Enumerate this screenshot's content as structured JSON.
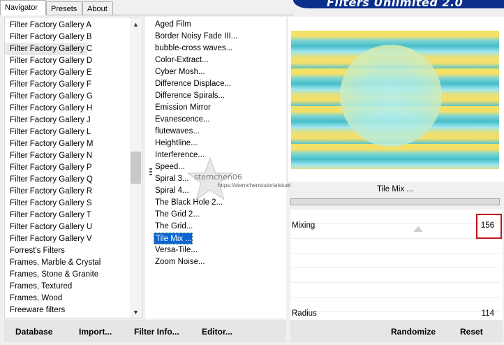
{
  "tabs": [
    {
      "label": "Navigator",
      "active": true
    },
    {
      "label": "Presets",
      "active": false
    },
    {
      "label": "About",
      "active": false
    }
  ],
  "banner": {
    "title": "Filters Unlimited 2.0",
    "color": "#0b2f8a"
  },
  "categories": [
    "Filter Factory Gallery A",
    "Filter Factory Gallery B",
    "Filter Factory Gallery C",
    "Filter Factory Gallery D",
    "Filter Factory Gallery E",
    "Filter Factory Gallery F",
    "Filter Factory Gallery G",
    "Filter Factory Gallery H",
    "Filter Factory Gallery J",
    "Filter Factory Gallery L",
    "Filter Factory Gallery M",
    "Filter Factory Gallery N",
    "Filter Factory Gallery P",
    "Filter Factory Gallery Q",
    "Filter Factory Gallery R",
    "Filter Factory Gallery S",
    "Filter Factory Gallery T",
    "Filter Factory Gallery U",
    "Filter Factory Gallery V",
    "Forrest's Filters",
    "Frames, Marble & Crystal",
    "Frames, Stone & Granite",
    "Frames, Textured",
    "Frames, Wood",
    "Freeware filters"
  ],
  "selected_category_index": 2,
  "filters": [
    "Aged Film",
    "Border Noisy Fade III...",
    "bubble-cross waves...",
    "Color-Extract...",
    "Cyber Mosh...",
    "Difference Displace...",
    "Difference Spirals...",
    "Emission Mirror",
    "Evanescence...",
    "flutewaves...",
    "Heightline...",
    "Interference...",
    "Speed...",
    "Spiral 3...",
    "Spiral 4...",
    "The Black Hole 2...",
    "The Grid 2...",
    "The Grid...",
    "Tile Mix ...",
    "Versa-Tile...",
    "Zoom Noise..."
  ],
  "selected_filter_index": 18,
  "watermark": {
    "text": "sternchen06",
    "url": "https://sternchenstutorialstuebchen.de/"
  },
  "current_filter_name": "Tile Mix ...",
  "controls": [
    {
      "label": "Mixing",
      "value": "156"
    },
    {
      "label": "Radius",
      "value": "114"
    }
  ],
  "buttons": {
    "database": "Database",
    "import": "Import...",
    "filter_info": "Filter Info...",
    "editor": "Editor...",
    "randomize": "Randomize",
    "reset": "Reset"
  },
  "colors": {
    "selection": "#0a64d2",
    "highlight_box": "#c0141c"
  }
}
